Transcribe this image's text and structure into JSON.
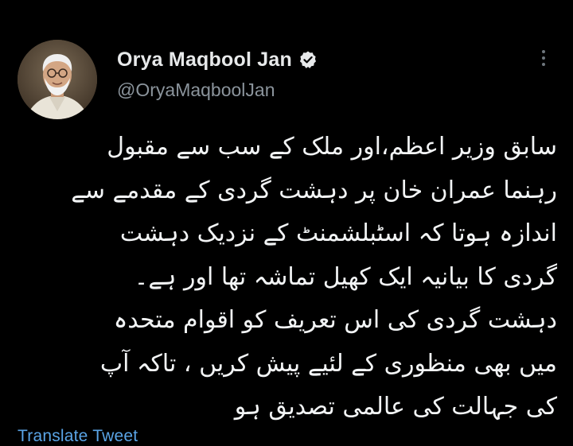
{
  "author": {
    "display_name": "Orya Maqbool Jan",
    "handle": "@OryaMaqboolJan",
    "verified": true,
    "avatar_icon": "profile-photo",
    "verified_color": "#e7e9ea"
  },
  "tweet": {
    "lines": [
      "سابق وزیر اعظم،اور ملک کے سب سے مقبول",
      "رہنما عمران خان پر دہشت گردی کے مقدمے سے",
      "اندازہ ہوتا کہ اسٹبلشمنٹ کے نزدیک دہشت",
      "گردی کا بیانیہ ایک کھیل تماشہ تھا اور ہے۔",
      "دہشت گردی کی اس تعریف کو اقوام متحدہ",
      "میں بھی منظوری کے لئیے پیش کریں ، تاکہ آپ",
      "کی جہالت کی عالمی تصدیق ہو"
    ],
    "translate_label": "Translate Tweet"
  },
  "colors": {
    "background": "#000000",
    "text": "#e7e9ea",
    "secondary_text": "#8b949c",
    "link": "#5aa4e6"
  },
  "icons": {
    "more": "more-options-icon",
    "verified": "verified-badge-icon"
  }
}
